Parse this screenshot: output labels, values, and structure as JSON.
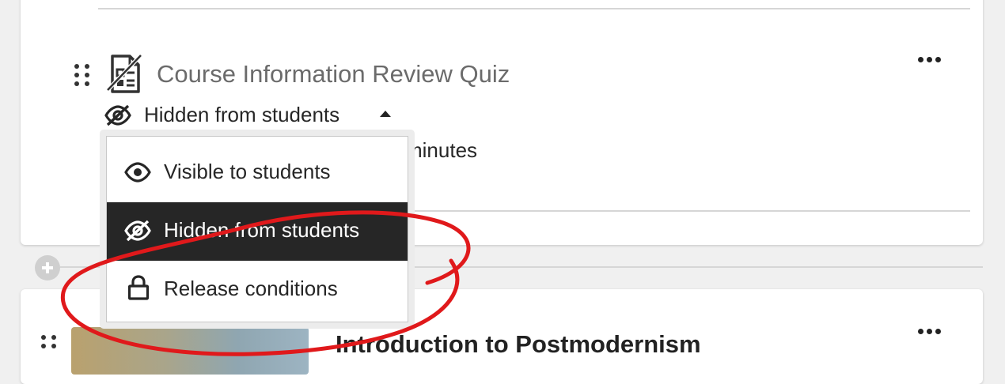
{
  "item": {
    "title": "Course Information Review Quiz",
    "visibility_status": "Hidden from students",
    "partial_text": "minutes"
  },
  "visibility_menu": {
    "items": [
      {
        "label": "Visible to students",
        "icon": "eye-icon",
        "selected": false
      },
      {
        "label": "Hidden from students",
        "icon": "eye-slash-icon",
        "selected": true
      },
      {
        "label": "Release conditions",
        "icon": "lock-icon",
        "selected": false
      }
    ]
  },
  "next_item": {
    "title": "Introduction to Postmodernism"
  },
  "colors": {
    "selected_bg": "#262626",
    "annotation": "#e0191b",
    "title_gray": "#6b6b6b"
  }
}
